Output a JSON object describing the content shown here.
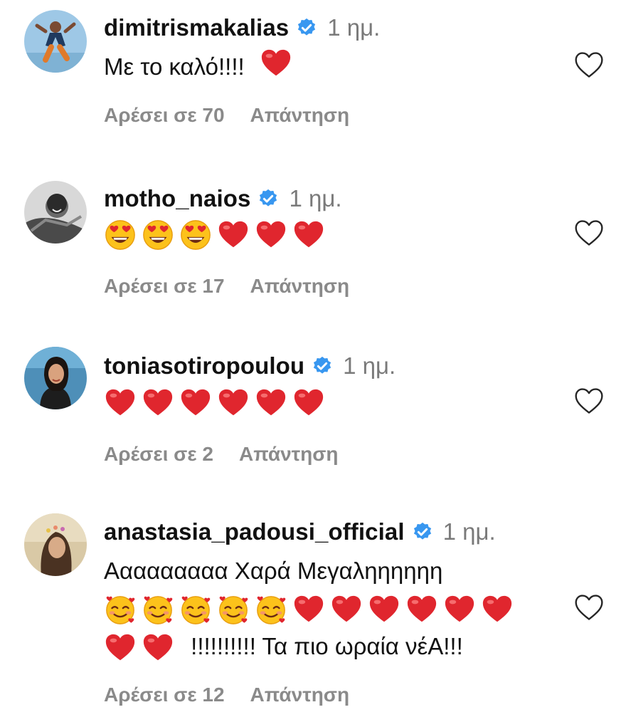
{
  "comments": [
    {
      "username": "dimitrismakalias",
      "time": "1 ημ.",
      "text_before": "Με το καλό!!!!",
      "emojis": [
        "heart"
      ],
      "likes": "Αρέσει σε 70",
      "reply": "Απάντηση"
    },
    {
      "username": "motho_naios",
      "time": "1 ημ.",
      "text_before": "",
      "emojis": [
        "heart-eyes",
        "heart-eyes",
        "heart-eyes",
        "heart",
        "heart",
        "heart"
      ],
      "likes": "Αρέσει σε 17",
      "reply": "Απάντηση"
    },
    {
      "username": "toniasotiropoulou",
      "time": "1 ημ.",
      "text_before": "",
      "emojis": [
        "heart",
        "heart",
        "heart",
        "heart",
        "heart",
        "heart"
      ],
      "likes": "Αρέσει σε 2",
      "reply": "Απάντηση"
    },
    {
      "username": "anastasia_padousi_official",
      "time": "1 ημ.",
      "line1": "Ααααααααα Χαρά Μεγαληηηηηη",
      "line2_emojis": [
        "smiling-hearts",
        "smiling-hearts",
        "smiling-hearts",
        "smiling-hearts",
        "smiling-hearts",
        "heart",
        "heart",
        "heart",
        "heart",
        "heart",
        "heart"
      ],
      "line3_emojis": [
        "heart",
        "heart"
      ],
      "line3_text": "!!!!!!!!!! Τα πιο ωραία νέΑ!!!",
      "likes": "Αρέσει σε 12",
      "reply": "Απάντηση"
    }
  ],
  "icons": {
    "verified": "verified-badge-icon",
    "like": "heart-outline-icon"
  },
  "colors": {
    "verified": "#3897f0",
    "heart": "#e0262e",
    "meta_text": "#8a8a8a",
    "time_text": "#7a7a7a"
  }
}
